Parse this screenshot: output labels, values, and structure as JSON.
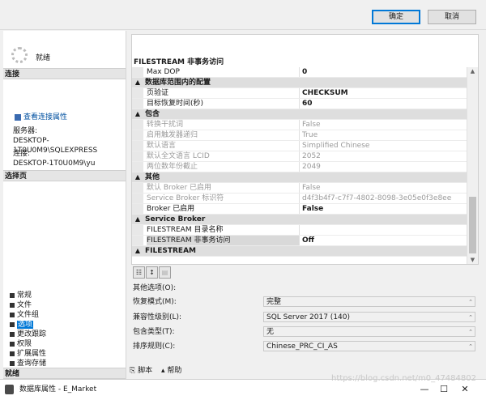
{
  "topbar": {
    "ok_label": "确定",
    "cancel_label": "取消"
  },
  "left": {
    "progress_label": "就绪",
    "section_connect": "连接",
    "view_connection_link": "查看连接属性",
    "server_label": "服务器:",
    "server_value": "DESKTOP-1T0U0M9\\SQLEXPRESS",
    "connection_label": "连接:",
    "connection_value": "DESKTOP-1T0U0M9\\yu",
    "section_select_page": "选择页",
    "nav": [
      "常规",
      "文件",
      "文件组",
      "选项",
      "更改跟踪",
      "权限",
      "扩展属性",
      "查询存储"
    ],
    "nav_selected_index": 3,
    "section_ready": "就绪"
  },
  "grid": {
    "title": "FILESTREAM 非事务访问",
    "rows": [
      {
        "type": "prop",
        "name": "Max DOP",
        "value": "0",
        "style": "bold"
      },
      {
        "type": "cat",
        "name": "数据库范围内的配置",
        "expander": "▲"
      },
      {
        "type": "prop",
        "name": "页验证",
        "value": "CHECKSUM",
        "style": "bold"
      },
      {
        "type": "prop",
        "name": "目标恢复时间(秒)",
        "value": "60",
        "style": "bold"
      },
      {
        "type": "cat",
        "name": "包含",
        "expander": "▲"
      },
      {
        "type": "prop",
        "name": "转换干扰词",
        "value": "False",
        "style": "dim"
      },
      {
        "type": "prop",
        "name": "启用触发器递归",
        "value": "True",
        "style": "dim"
      },
      {
        "type": "prop",
        "name": "默认语言",
        "value": "Simplified Chinese",
        "style": "dim"
      },
      {
        "type": "prop",
        "name": "默认全文语言 LCID",
        "value": "2052",
        "style": "dim"
      },
      {
        "type": "prop",
        "name": "两位数年份截止",
        "value": "2049",
        "style": "dim"
      },
      {
        "type": "cat",
        "name": "其他",
        "expander": "▲"
      },
      {
        "type": "prop",
        "name": "默认 Broker 已启用",
        "value": "False",
        "style": "dim"
      },
      {
        "type": "prop",
        "name": "Service Broker 标识符",
        "value": "d4f3b4f7-c7f7-4802-8098-3e05e0f3e8ee",
        "style": "dim"
      },
      {
        "type": "prop",
        "name": "Broker 已启用",
        "value": "False",
        "style": "bold"
      },
      {
        "type": "cat",
        "name": "Service Broker",
        "expander": "▲"
      },
      {
        "type": "prop",
        "name": "FILESTREAM 目录名称",
        "value": "",
        "style": ""
      },
      {
        "type": "prop",
        "name": "FILESTREAM 非事务访问",
        "value": "Off",
        "style": "bold-sel"
      },
      {
        "type": "cat",
        "name": "FILESTREAM",
        "expander": "▲"
      }
    ]
  },
  "form": {
    "owner_label": "其他选项(O):",
    "rows": [
      {
        "label": "恢复模式(M):",
        "value": "完整"
      },
      {
        "label": "兼容性级别(L):",
        "value": "SQL Server 2017 (140)"
      },
      {
        "label": "包含类型(T):",
        "value": "无"
      },
      {
        "label": "排序规则(C):",
        "value": "Chinese_PRC_CI_AS"
      }
    ]
  },
  "bottom": {
    "script_label": "脚本",
    "help_label": "帮助"
  },
  "status": {
    "title": "数据库属性 - E_Market"
  },
  "watermark": "https://blog.csdn.net/m0_47484802"
}
